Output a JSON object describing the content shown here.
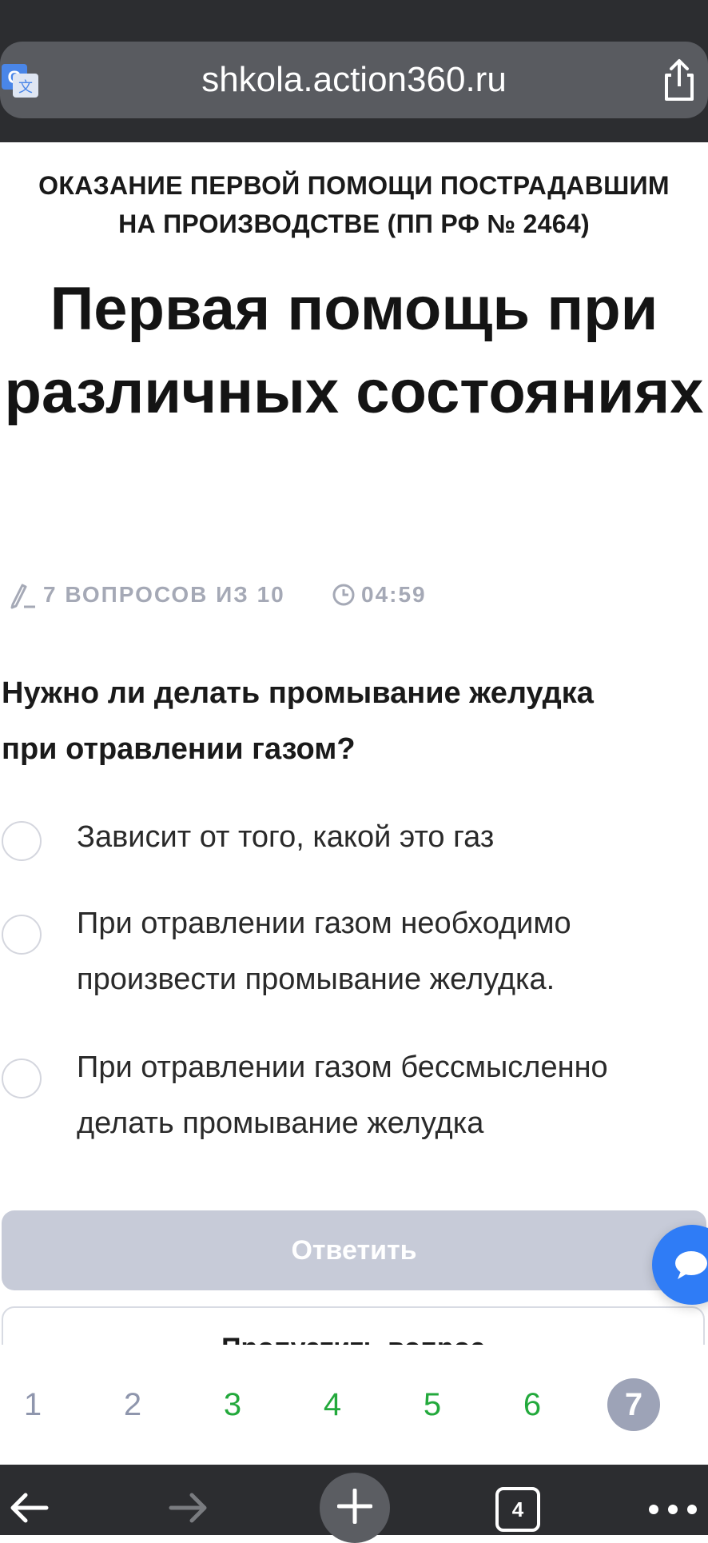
{
  "browser": {
    "url": "shkola.action360.ru",
    "tabs_count": "4"
  },
  "course": {
    "header_line1": "ОКАЗАНИЕ ПЕРВОЙ ПОМОЩИ ПОСТРАДАВШИМ",
    "header_line2": "НА ПРОИЗВОДСТВЕ (ПП РФ № 2464)",
    "title_line1": "Первая помощь при",
    "title_line2": "различных состояниях"
  },
  "quiz": {
    "questions_count": "7 ВОПРОСОВ ИЗ 10",
    "timer": "04:59",
    "question_line1": "Нужно ли делать промывание желудка",
    "question_line2": "при отравлении газом?",
    "options": [
      {
        "line1": "Зависит от того, какой это газ",
        "line2": ""
      },
      {
        "line1": "При отравлении газом необходимо",
        "line2": "произвести промывание желудка."
      },
      {
        "line1": "При отравлении газом бессмысленно",
        "line2": "делать промывание желудка"
      }
    ],
    "answer_label": "Ответить",
    "skip_label": "Пропустить вопрос"
  },
  "pager": {
    "pages": [
      {
        "label": "1",
        "state": "unanswered"
      },
      {
        "label": "2",
        "state": "unanswered"
      },
      {
        "label": "3",
        "state": "answered"
      },
      {
        "label": "4",
        "state": "answered"
      },
      {
        "label": "5",
        "state": "answered"
      },
      {
        "label": "6",
        "state": "answered"
      },
      {
        "label": "7",
        "state": "current"
      }
    ]
  },
  "colors": {
    "answered": "#23a93c",
    "unanswered": "#8f96ad",
    "current_bg": "#9da3b7",
    "chat_button": "#2f7cf6"
  }
}
